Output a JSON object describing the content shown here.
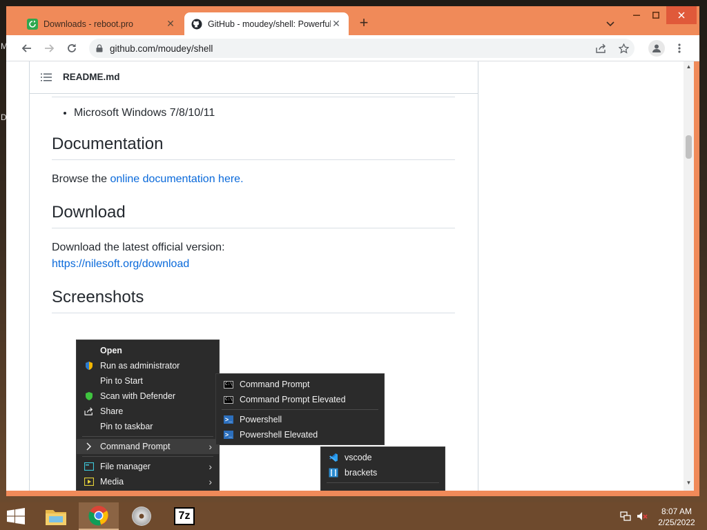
{
  "desktop": {
    "letters": [
      "M",
      "D"
    ]
  },
  "browser": {
    "tabs": [
      {
        "title": "Downloads - reboot.pro",
        "active": false,
        "icon": "green-refresh-icon"
      },
      {
        "title": "GitHub - moudey/shell: Powerful",
        "active": true,
        "icon": "github-icon"
      }
    ],
    "new_tab_label": "+",
    "url": "github.com/moudey/shell",
    "colors": {
      "frame": "#f08a59",
      "link": "#0969da",
      "close": "#e0593a"
    }
  },
  "readme": {
    "header": "README.md",
    "bullet": "Microsoft Windows 7/8/10/11",
    "documentation": {
      "heading": "Documentation",
      "text": "Browse the ",
      "link": "online documentation here."
    },
    "download": {
      "heading": "Download",
      "text": "Download the latest official version:",
      "link": "https://nilesoft.org/download"
    },
    "screenshots": {
      "heading": "Screenshots"
    }
  },
  "screenshot_menu": {
    "main": [
      {
        "label": "Open",
        "bold": true,
        "icon": ""
      },
      {
        "label": "Run as administrator",
        "icon": "shield-icon"
      },
      {
        "label": "Pin to Start",
        "icon": ""
      },
      {
        "label": "Scan with Defender",
        "icon": "defender-icon"
      },
      {
        "label": "Share",
        "icon": "share-icon"
      },
      {
        "label": "Pin to taskbar",
        "icon": ""
      },
      {
        "label": "Command Prompt",
        "icon": "chevron-icon",
        "submenu": true
      },
      {
        "label": "File manager",
        "icon": "file-manager-icon",
        "submenu": true
      },
      {
        "label": "Media",
        "icon": "media-icon",
        "submenu": true
      }
    ],
    "submenu": [
      {
        "label": "Command Prompt",
        "icon": "cmd-icon"
      },
      {
        "label": "Command Prompt Elevated",
        "icon": "cmd-icon"
      },
      {
        "label": "Powershell",
        "icon": "powershell-icon"
      },
      {
        "label": "Powershell Elevated",
        "icon": "powershell-icon"
      }
    ],
    "editors": [
      {
        "label": "vscode",
        "icon": "vscode-icon"
      },
      {
        "label": "brackets",
        "icon": "brackets-icon"
      }
    ]
  },
  "taskbar": {
    "cmd_glyph": "C:\\",
    "ps_glyph": ">_",
    "clock_time": "8:07 AM",
    "clock_date": "2/25/2022",
    "apps": [
      "file-explorer-icon",
      "chrome-icon",
      "disc-icon",
      "7zip-icon"
    ],
    "seven_zip_label": "7z"
  }
}
